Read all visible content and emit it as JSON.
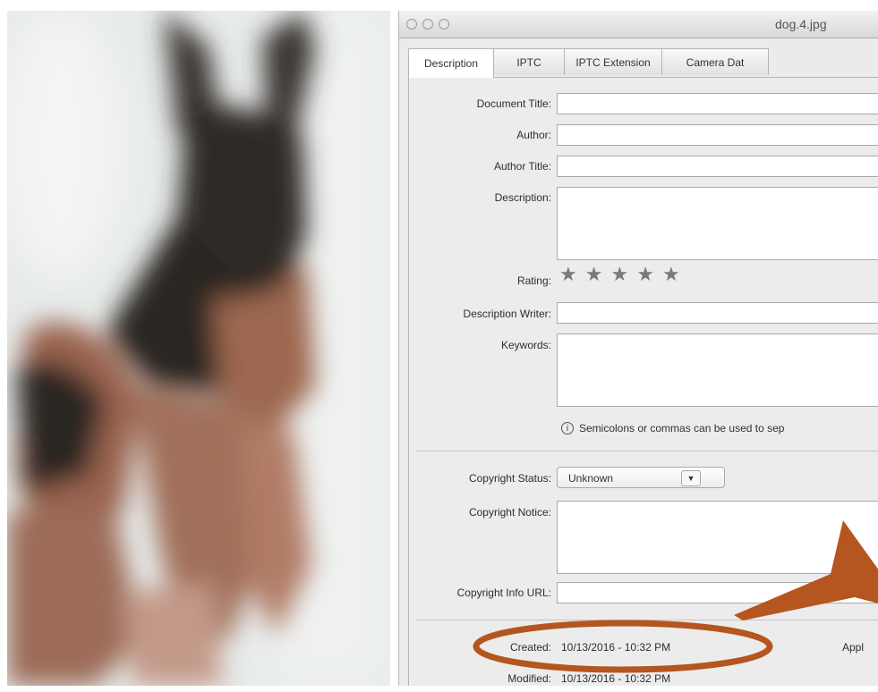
{
  "window": {
    "title": "dog.4.jpg"
  },
  "tabs": [
    {
      "label": "Description"
    },
    {
      "label": "IPTC"
    },
    {
      "label": "IPTC Extension"
    },
    {
      "label": "Camera Dat"
    }
  ],
  "fields": {
    "document_title": {
      "label": "Document Title:",
      "value": ""
    },
    "author": {
      "label": "Author:",
      "value": ""
    },
    "author_title": {
      "label": "Author Title:",
      "value": ""
    },
    "description": {
      "label": "Description:",
      "value": ""
    },
    "rating": {
      "label": "Rating:",
      "stars_total": 5,
      "stars_filled": 0
    },
    "description_writer": {
      "label": "Description Writer:",
      "value": ""
    },
    "keywords": {
      "label": "Keywords:",
      "value": ""
    },
    "keywords_hint": "Semicolons or commas can be used to sep",
    "copyright_status": {
      "label": "Copyright Status:",
      "value": "Unknown"
    },
    "copyright_notice": {
      "label": "Copyright Notice:",
      "value": ""
    },
    "copyright_info_url": {
      "label": "Copyright Info URL:",
      "value": ""
    }
  },
  "footer": {
    "created_label": "Created:",
    "created_value": "10/13/2016 - 10:32 PM",
    "modified_label": "Modified:",
    "modified_value": "10/13/2016 - 10:32 PM",
    "application_label": "Appl"
  },
  "colors": {
    "annotation": "#b5551f",
    "dog_dark": "#2c2623",
    "dog_tan": "#a56e55"
  }
}
